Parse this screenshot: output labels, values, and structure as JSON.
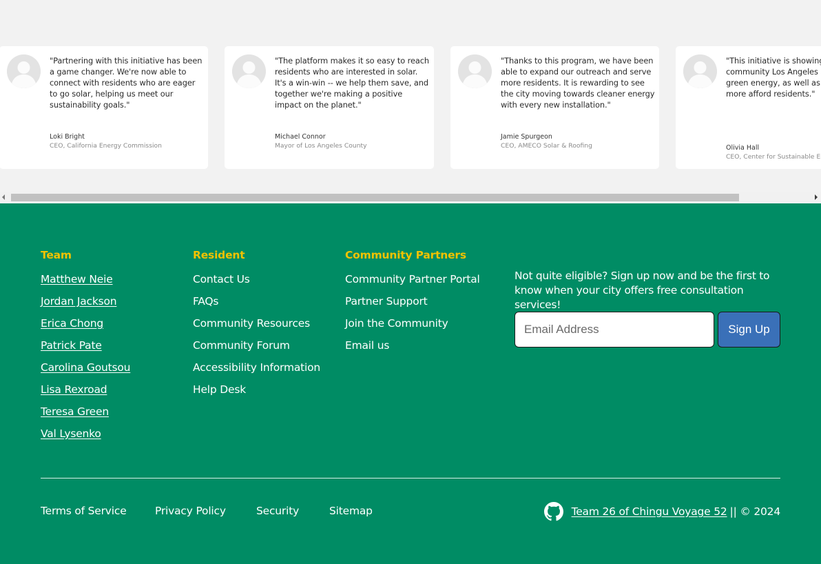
{
  "testimonials": [
    {
      "quote": "\"Partnering with this initiative has been a game changer. We're now able to connect with residents who are eager to go solar, helping us meet our sustainability goals.\"",
      "name": "Loki Bright",
      "role": "CEO, California Energy Commission",
      "icon": "avatar-placeholder-icon"
    },
    {
      "quote": "\"The platform makes it so easy to reach residents who are interested in solar. It's a win-win -- we help them save, and together we're making a positive impact on the planet.\"",
      "name": "Michael Connor",
      "role": "Mayor of Los Angeles County",
      "icon": "avatar-placeholder-icon"
    },
    {
      "quote": "\"Thanks to this program, we have been able to expand our outreach and serve more residents. It is rewarding to see the city moving towards cleaner energy with every new installation.\"",
      "name": "Jamie Spurgeon",
      "role": "CEO, AMECO Solar & Roofing",
      "icon": "avatar-placeholder-icon"
    },
    {
      "quote": "\"This initiative is showing impact on our community Los Angeles is surpassing green energy, as well as cost of living more afford residents.\"",
      "name": "Olivia Hall",
      "role": "CEO, Center for Sustainable Ene",
      "icon": "avatar-placeholder-icon"
    }
  ],
  "scrollbar": {
    "position": 0
  },
  "footer": {
    "colors": {
      "background": "#008c64",
      "heading": "#f2c200",
      "button": "#3a70b8"
    },
    "team": {
      "heading": "Team",
      "links": [
        "Matthew Neie",
        "Jordan Jackson",
        "Erica Chong",
        "Patrick Pate",
        "Carolina Goutsou",
        "Lisa Rexroad",
        "Teresa Green",
        "Val Lysenko"
      ]
    },
    "resident": {
      "heading": "Resident",
      "links": [
        "Contact Us",
        "FAQs",
        "Community Resources",
        "Community Forum",
        "Accessibility Information",
        "Help Desk"
      ]
    },
    "partners": {
      "heading": "Community Partners",
      "links": [
        "Community Partner Portal",
        "Partner Support",
        "Join the Community",
        "Email us"
      ]
    },
    "signup": {
      "text": "Not quite eligible? Sign up now and be the first to know when your city offers free consultation services!",
      "email_placeholder": "Email Address",
      "button_label": "Sign Up"
    },
    "bottom_links": {
      "terms": "Terms of Service",
      "privacy": "Privacy Policy",
      "security": "Security",
      "sitemap": "Sitemap"
    },
    "credit": {
      "icon": "github-icon",
      "link_text": "Team 26 of Chingu Voyage 52",
      "suffix": "|| © 2024"
    }
  }
}
